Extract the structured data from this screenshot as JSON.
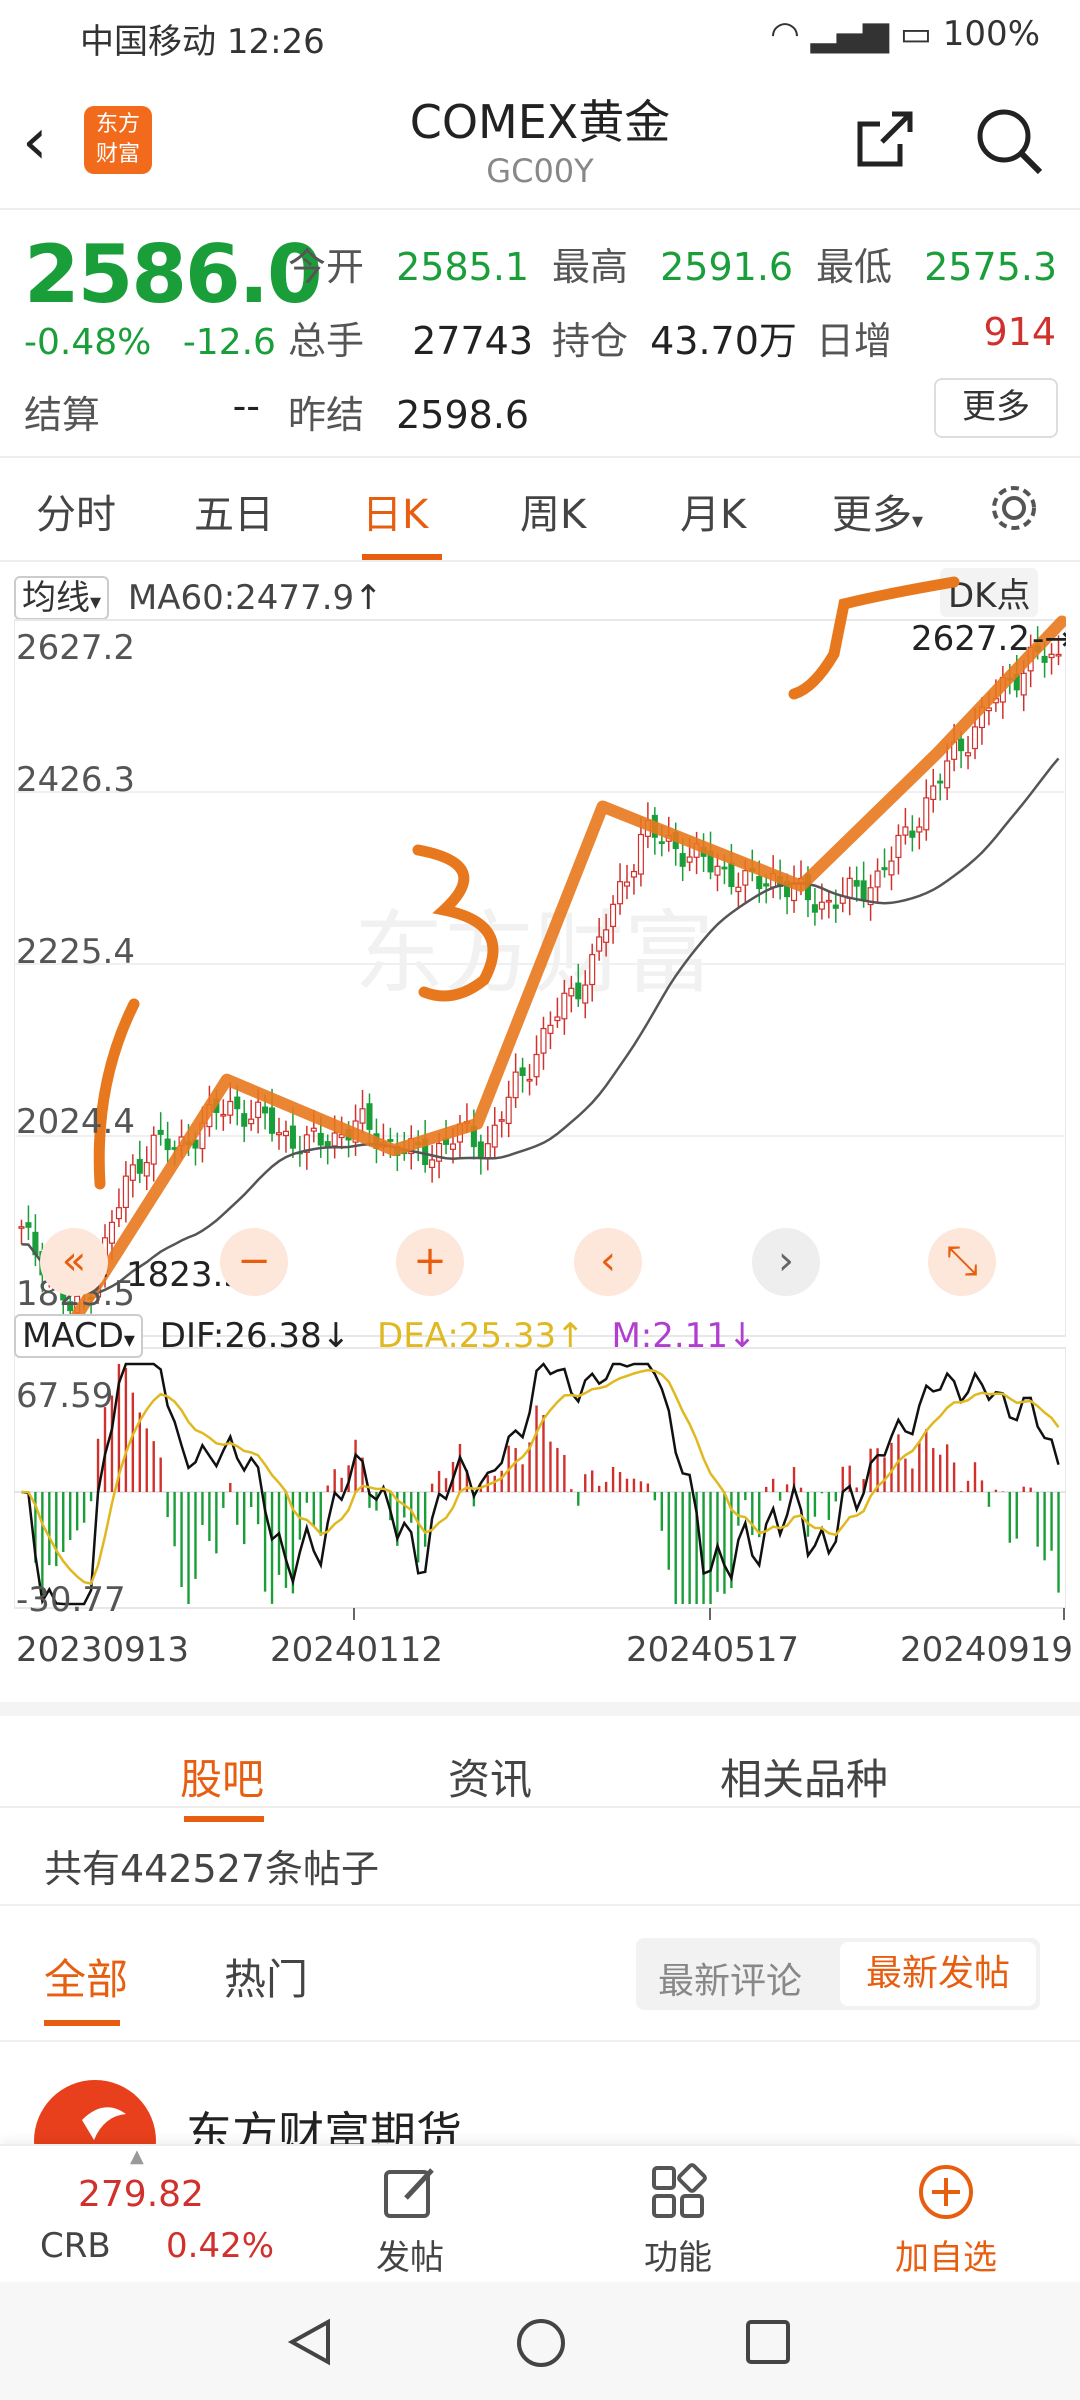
{
  "status": {
    "carrier": "中国移动",
    "time": "12:26",
    "battery": "100%"
  },
  "header": {
    "title": "COMEX黄金",
    "code": "GC00Y",
    "logo_line1": "东方",
    "logo_line2": "财富"
  },
  "quote": {
    "price": "2586.0",
    "pct": "-0.48%",
    "change": "-12.6",
    "open_label": "今开",
    "open": "2585.1",
    "high_label": "最高",
    "high": "2591.6",
    "low_label": "最低",
    "low": "2575.3",
    "volume_label": "总手",
    "volume": "27743",
    "oi_label": "持仓",
    "oi": "43.70万",
    "daily_inc_label": "日增",
    "daily_inc": "914",
    "settle_label": "结算",
    "settle": "--",
    "prev_settle_label": "昨结",
    "prev_settle": "2598.6",
    "more_label": "更多"
  },
  "period_tabs": [
    {
      "label": "分时"
    },
    {
      "label": "五日"
    },
    {
      "label": "日K"
    },
    {
      "label": "周K"
    },
    {
      "label": "月K"
    },
    {
      "label": "更多"
    }
  ],
  "chart": {
    "ma_select": "均线",
    "ma60": "MA60:2477.9",
    "ma_arrow": "↑",
    "dk_label": "DK点",
    "y_ticks": [
      "2627.2",
      "2426.3",
      "2225.4",
      "2024.4",
      "1823.5"
    ],
    "high_mark": "2627.2",
    "low_mark": "1823.5",
    "macd_select": "MACD",
    "dif": "DIF:26.38",
    "dea": "DEA:25.33",
    "m": "M:2.11",
    "dif_arrow": "↓",
    "dea_arrow": "↑",
    "m_arrow": "↓",
    "macd_top": "67.59",
    "macd_bottom": "-30.77",
    "dates": [
      "20230913",
      "20240112",
      "20240517",
      "20240919"
    ],
    "colors": {
      "up": "#d0312d",
      "down": "#1a9e3a",
      "dif": "#111111",
      "dea": "#e0b820",
      "m": "#b03fd0",
      "drawing": "#e8781e"
    },
    "watermark": "东方财富"
  },
  "chart_data": {
    "type": "candlestick",
    "title": "",
    "x_range": [
      "20230913",
      "20240919"
    ],
    "ylim": [
      1823.5,
      2627.2
    ],
    "y_ticks": [
      2627.2,
      2426.3,
      2225.4,
      2024.4,
      1823.5
    ],
    "close_trend": [
      1935,
      1900,
      1840,
      1900,
      1990,
      2040,
      2030,
      2060,
      2080,
      2070,
      2050,
      2035,
      2045,
      2060,
      2040,
      2025,
      2030,
      2050,
      2035,
      2100,
      2150,
      2200,
      2240,
      2320,
      2390,
      2380,
      2360,
      2350,
      2330,
      2340,
      2320,
      2310,
      2320,
      2340,
      2380,
      2430,
      2480,
      2520,
      2560,
      2590,
      2586.0
    ],
    "ma60": 2477.9,
    "macd": {
      "dif": 26.38,
      "dea": 25.33,
      "m": 2.11,
      "range": [
        -30.77,
        67.59
      ]
    }
  },
  "bottom_tabs": [
    {
      "label": "股吧"
    },
    {
      "label": "资讯"
    },
    {
      "label": "相关品种"
    }
  ],
  "forum": {
    "posts_count": "共有442527条帖子",
    "filter_all": "全部",
    "filter_hot": "热门",
    "sort_comment": "最新评论",
    "sort_post": "最新发帖",
    "first_author": "东方财富期货"
  },
  "toolbar": {
    "crb_value": "279.82",
    "crb_name": "CRB",
    "crb_pct": "0.42%",
    "post_label": "发帖",
    "function_label": "功能",
    "watch_label": "加自选"
  }
}
